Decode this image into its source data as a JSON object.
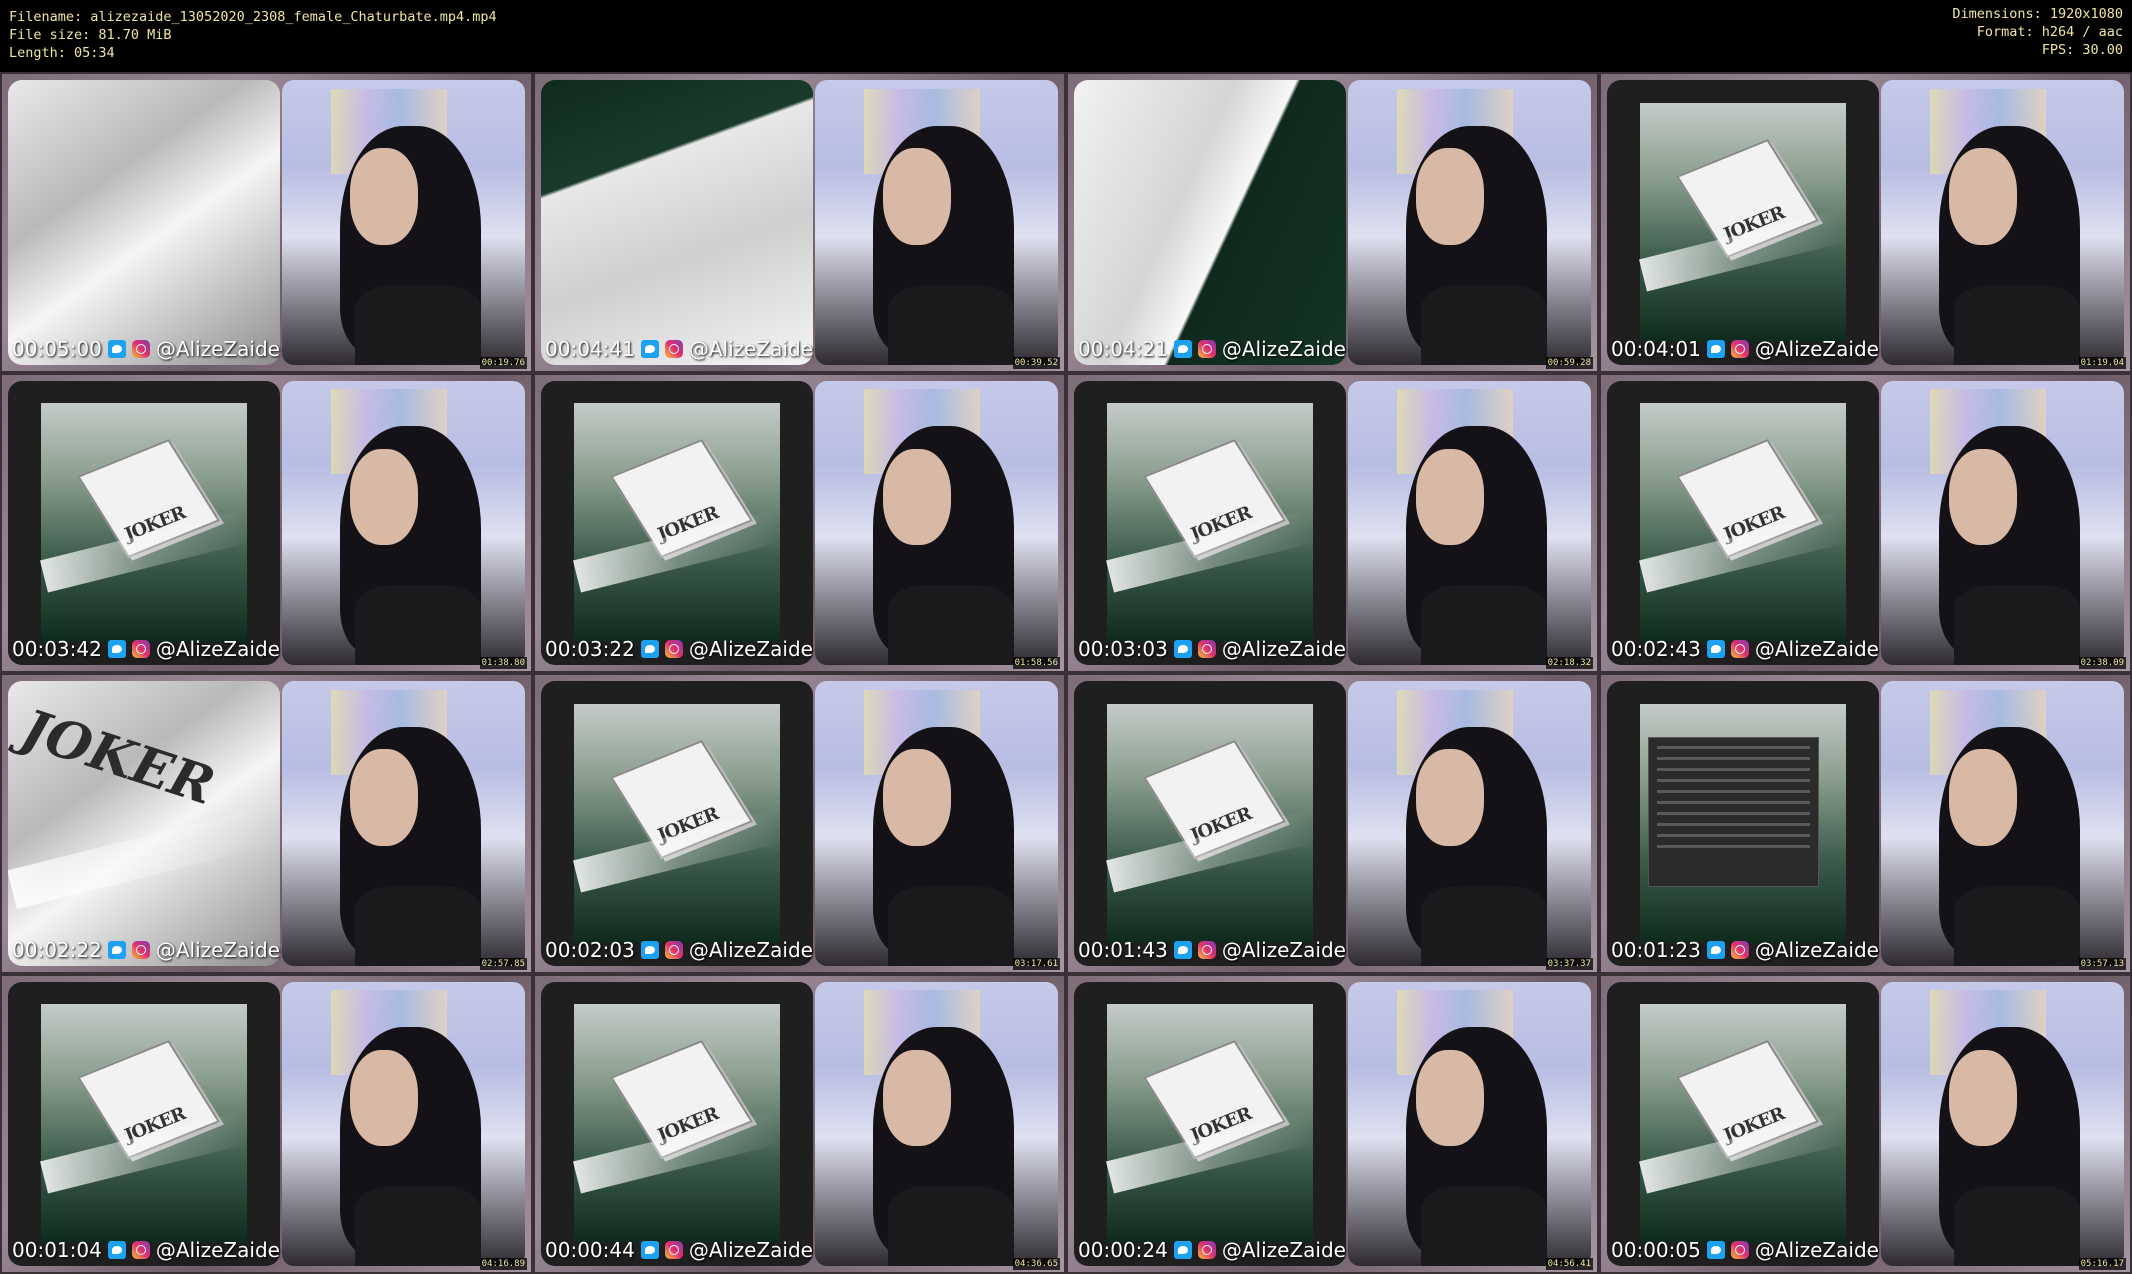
{
  "header": {
    "filename": "Filename: alizezaide_13052020_2308_female_Chaturbate.mp4.mp4",
    "filesize": "File size: 81.70 MiB",
    "length": "Length: 05:34",
    "dimensions": "Dimensions: 1920x1080",
    "format": "Format: h264 / aac",
    "fps": "FPS: 30.00"
  },
  "handle": "@AlizeZaide",
  "thumbs": [
    {
      "overlay_time": "00:05:00",
      "timestamp": "00:19.76",
      "scene": "hex-close"
    },
    {
      "overlay_time": "00:04:41",
      "timestamp": "00:39.52",
      "scene": "hex-dark"
    },
    {
      "overlay_time": "00:04:21",
      "timestamp": "00:59.28",
      "scene": "hex-corner"
    },
    {
      "overlay_time": "00:04:01",
      "timestamp": "01:19.04",
      "scene": "card"
    },
    {
      "overlay_time": "00:03:42",
      "timestamp": "01:38.80",
      "scene": "card"
    },
    {
      "overlay_time": "00:03:22",
      "timestamp": "01:58.56",
      "scene": "card"
    },
    {
      "overlay_time": "00:03:03",
      "timestamp": "02:18.32",
      "scene": "card"
    },
    {
      "overlay_time": "00:02:43",
      "timestamp": "02:38.09",
      "scene": "card"
    },
    {
      "overlay_time": "00:02:22",
      "timestamp": "02:57.85",
      "scene": "joker-close"
    },
    {
      "overlay_time": "00:02:03",
      "timestamp": "03:17.61",
      "scene": "card"
    },
    {
      "overlay_time": "00:01:43",
      "timestamp": "03:37.37",
      "scene": "card"
    },
    {
      "overlay_time": "00:01:23",
      "timestamp": "03:57.13",
      "scene": "dialog"
    },
    {
      "overlay_time": "00:01:04",
      "timestamp": "04:16.89",
      "scene": "card"
    },
    {
      "overlay_time": "00:00:44",
      "timestamp": "04:36.65",
      "scene": "card"
    },
    {
      "overlay_time": "00:00:24",
      "timestamp": "04:56.41",
      "scene": "card"
    },
    {
      "overlay_time": "00:00:05",
      "timestamp": "05:16.17",
      "scene": "card"
    }
  ],
  "card_label": "JOKER",
  "colors": {
    "header_text": "#f0e6a0",
    "background": "#000000",
    "twitter": "#1da1f2"
  }
}
